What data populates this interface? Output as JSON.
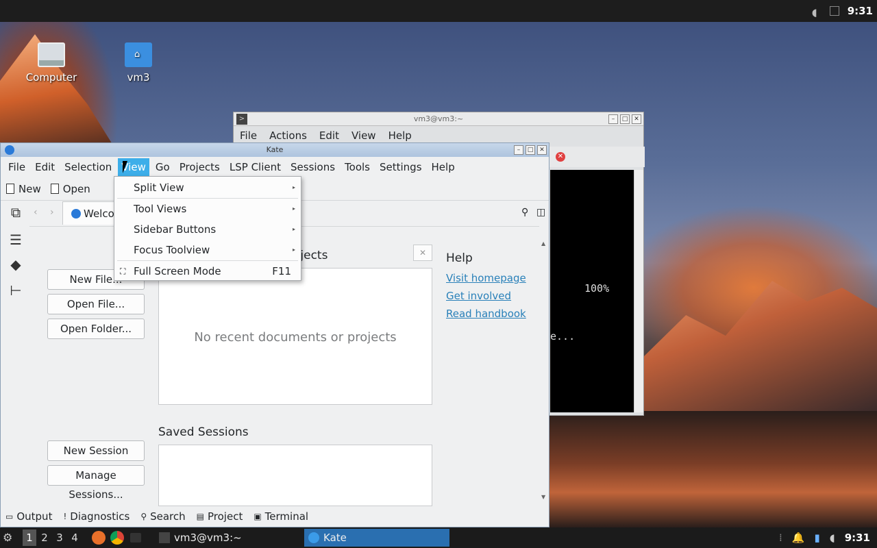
{
  "top_panel": {
    "clock": "9:31"
  },
  "desktop": {
    "icons": [
      {
        "label": "Computer"
      },
      {
        "label": "vm3"
      }
    ]
  },
  "terminal": {
    "title": "vm3@vm3:~",
    "menu": [
      "File",
      "Actions",
      "Edit",
      "View",
      "Help"
    ],
    "percent": "100%",
    "partial_line": "e..."
  },
  "kate": {
    "title": "Kate",
    "menu": [
      "File",
      "Edit",
      "Selection",
      "View",
      "Go",
      "Projects",
      "LSP Client",
      "Sessions",
      "Tools",
      "Settings",
      "Help"
    ],
    "toolbar": {
      "new_label": "New",
      "open_label": "Open"
    },
    "tab_label": "Welcome",
    "welcome": {
      "new_file": "New File...",
      "open_file": "Open File...",
      "open_folder": "Open Folder...",
      "recent_heading": "Recent Documents and Projects",
      "recent_heading_visible": "ojects",
      "recent_empty": "No recent documents or projects",
      "saved_sessions_heading": "Saved Sessions",
      "new_session": "New Session",
      "manage_sessions": "Manage Sessions...",
      "help_heading": "Help",
      "help_links": [
        "Visit homepage",
        "Get involved",
        "Read handbook"
      ]
    },
    "bottom_tools": [
      "Output",
      "Diagnostics",
      "Search",
      "Project",
      "Terminal"
    ]
  },
  "view_menu": {
    "items": [
      {
        "label": "Split View",
        "submenu": true
      },
      {
        "label": "Tool Views",
        "submenu": true
      },
      {
        "label": "Sidebar Buttons",
        "submenu": true
      },
      {
        "label": "Focus Toolview",
        "submenu": true
      },
      {
        "label": "Full Screen Mode",
        "shortcut": "F11"
      }
    ]
  },
  "taskbar": {
    "workspaces": [
      "1",
      "2",
      "3",
      "4"
    ],
    "tasks": [
      {
        "label": "vm3@vm3:~"
      },
      {
        "label": "Kate"
      }
    ],
    "clock": "9:31"
  },
  "colors": {
    "accent": "#3daee9",
    "active_task": "#2a6fb0",
    "link": "#2980b9"
  }
}
